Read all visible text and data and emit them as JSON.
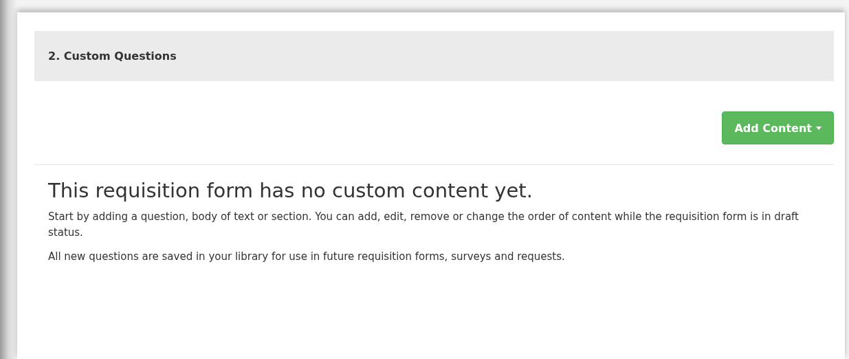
{
  "section": {
    "title": "2. Custom Questions"
  },
  "add_button": {
    "label": "Add Content"
  },
  "empty_state": {
    "heading": "This requisition form has no custom content yet.",
    "paragraphs": [
      "Start by adding a question, body of text or section. You can add, edit, remove or change the order of content while the requisition form is in draft status.",
      "All new questions are saved in your library for use in future requisition forms, surveys and requests."
    ]
  }
}
